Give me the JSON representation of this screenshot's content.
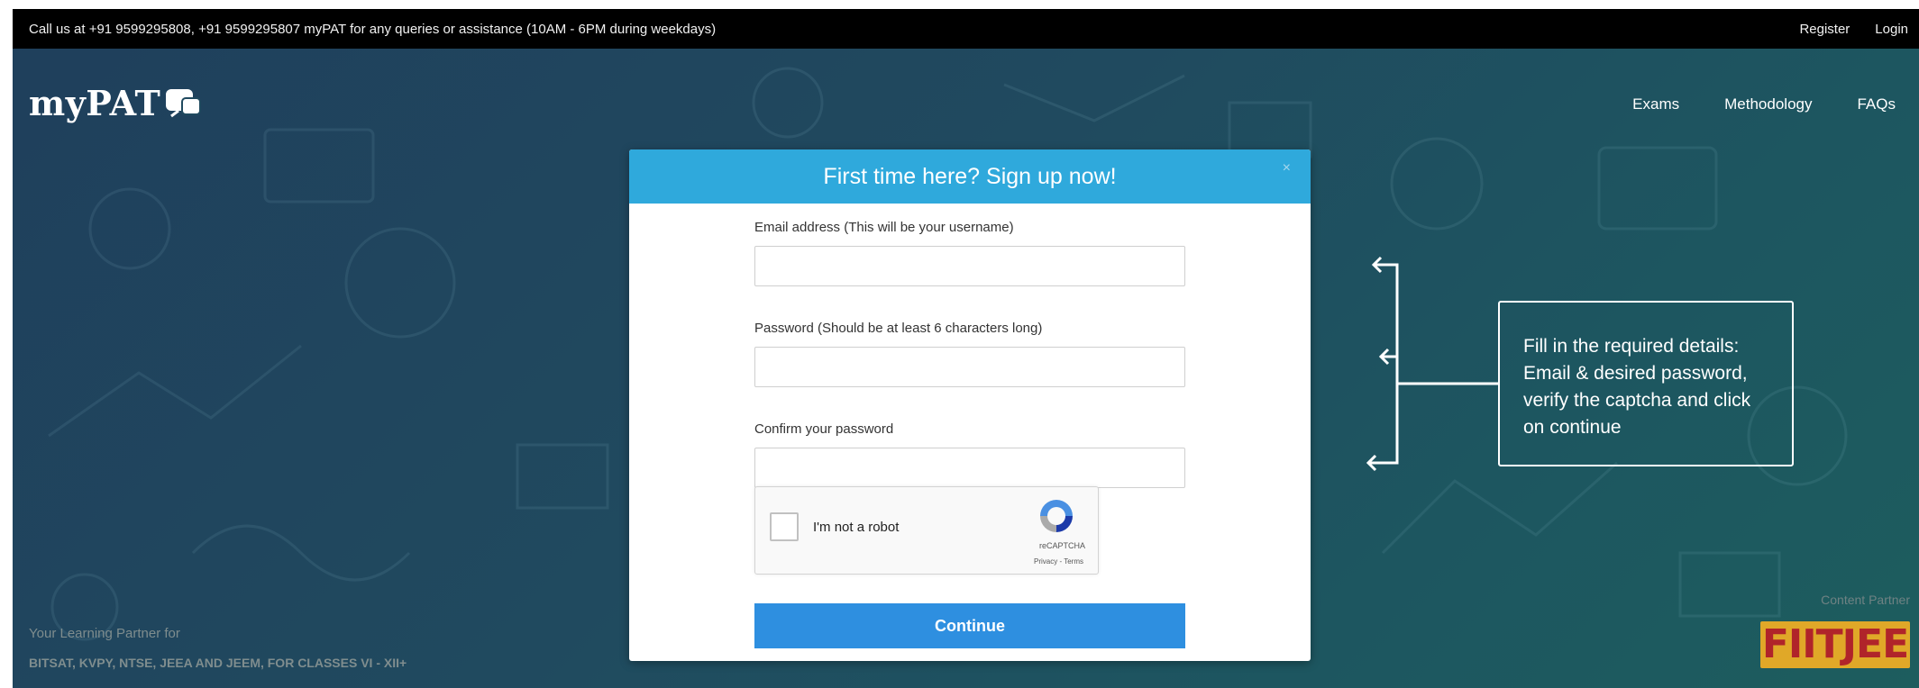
{
  "topbar": {
    "contact_text": "Call us at +91 9599295808, +91 9599295807 myPAT for any queries or assistance (10AM - 6PM during weekdays)",
    "register_label": "Register",
    "login_label": "Login"
  },
  "header": {
    "logo_text": "myPAT",
    "nav": [
      "Exams",
      "Methodology",
      "FAQs"
    ]
  },
  "modal": {
    "title": "First time here? Sign up now!",
    "close_label": "×",
    "email_label": "Email address (This will be your username)",
    "email_value": "",
    "password_label": "Password (Should be at least 6 characters long)",
    "password_value": "",
    "confirm_label": "Confirm your password",
    "confirm_value": "",
    "captcha": {
      "label": "I'm not a robot",
      "brand": "reCAPTCHA",
      "terms": "Privacy - Terms"
    },
    "continue_label": "Continue"
  },
  "callout": {
    "lines": [
      "Fill in the required details:",
      "Email & desired password,",
      "verify the captcha and click",
      "on continue"
    ]
  },
  "footer": {
    "partner_line1": "Your Learning Partner for",
    "partner_line2": "BITSAT, KVPY, NTSE, JEEA AND JEEM, FOR CLASSES VI - XII+",
    "content_partner_label": "Content Partner",
    "content_partner_logo": "FIITJEE"
  },
  "colors": {
    "topbar_bg": "#000000",
    "modal_header_bg": "#2fa9dc",
    "continue_bg": "#2e8fe0",
    "page_bg": "#204a5f"
  }
}
